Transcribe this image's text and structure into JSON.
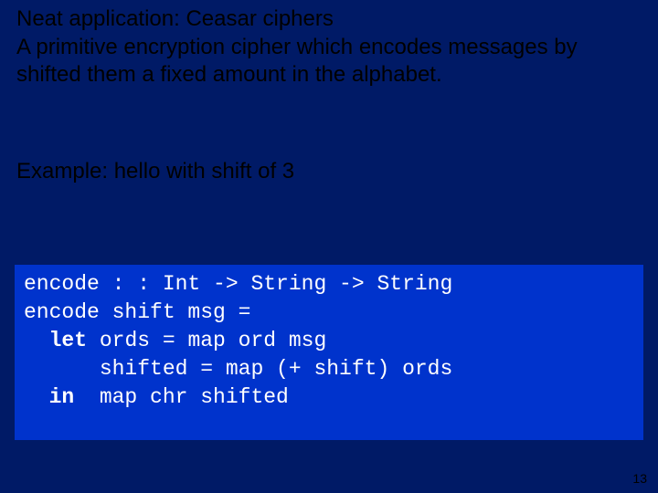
{
  "heading": {
    "line1": "Neat application: Ceasar ciphers",
    "line2": "A primitive encryption cipher which encodes messages by shifted them a fixed amount in the alphabet."
  },
  "example": "Example: hello with shift of 3",
  "code": {
    "l1a": "encode : : Int -> String -> String",
    "l2a": "encode shift msg =",
    "l3_kw": "let",
    "l3_rest": " ords = map ord msg",
    "l4": "      shifted = map (+ shift) ords",
    "l5_kw": "in",
    "l5_rest": "  map chr shifted"
  },
  "page": "13"
}
